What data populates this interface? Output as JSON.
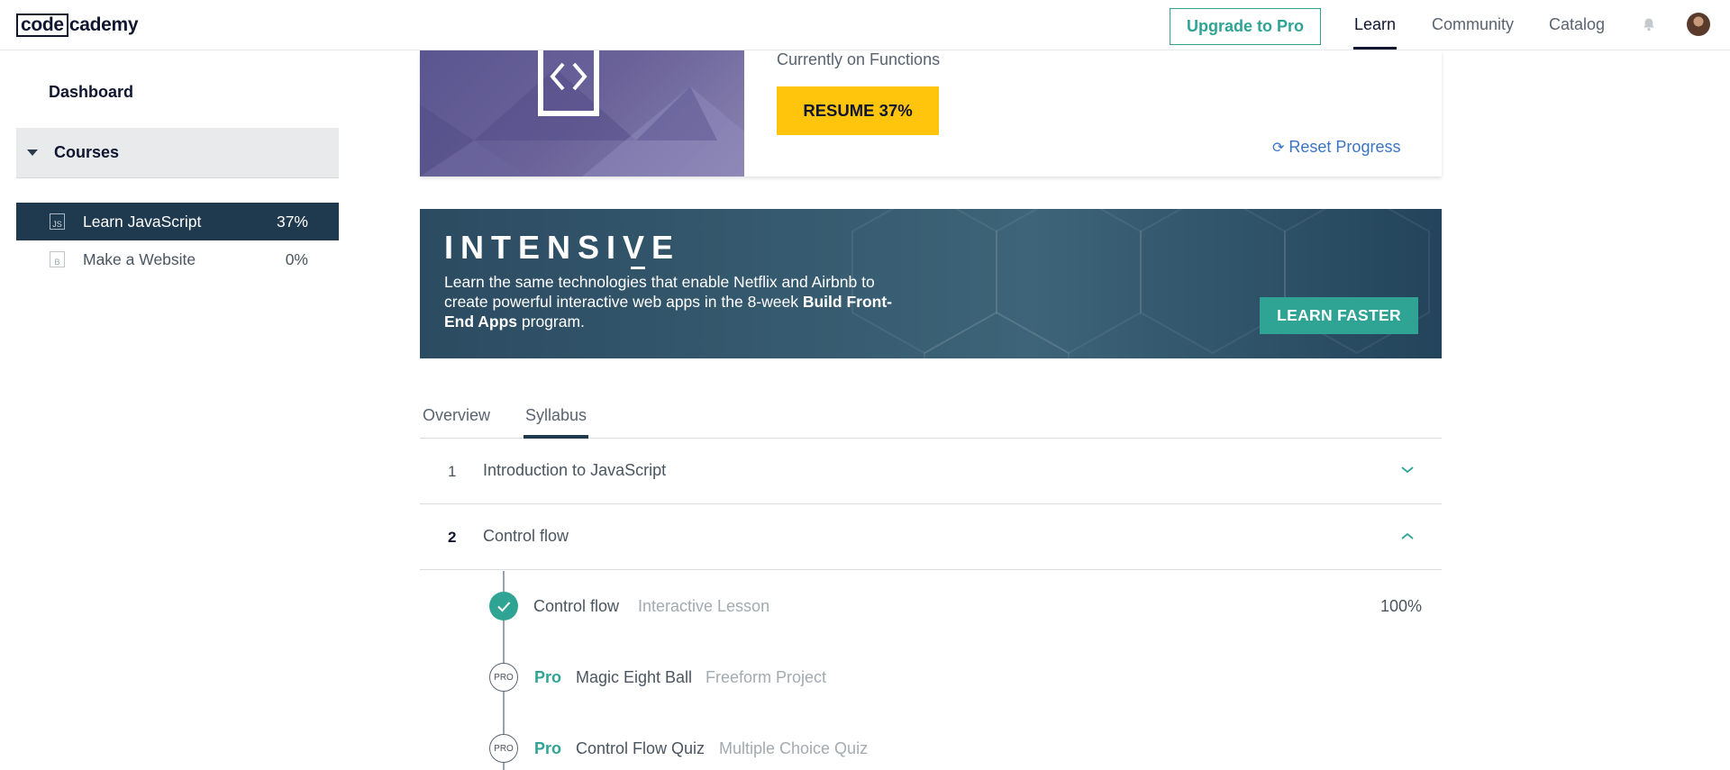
{
  "header": {
    "logo_box": "code",
    "logo_rest": "cademy",
    "upgrade_label": "Upgrade to Pro",
    "nav": [
      "Learn",
      "Community",
      "Catalog"
    ]
  },
  "sidebar": {
    "dashboard": "Dashboard",
    "courses_label": "Courses",
    "courses": [
      {
        "icon": "JS",
        "name": "Learn JavaScript",
        "pct": "37%",
        "active": true
      },
      {
        "icon": "B",
        "name": "Make a Website",
        "pct": "0%",
        "active": false
      }
    ]
  },
  "hero": {
    "currently": "Currently on Functions",
    "resume_label": "RESUME 37%",
    "reset_label": "Reset Progress"
  },
  "banner": {
    "title": "INTENSIVE",
    "desc_part1": "Learn the same technologies that enable Netflix and Airbnb to create powerful interactive web apps in the 8-week ",
    "desc_bold": "Build Front-End Apps",
    "desc_part2": " program.",
    "cta": "LEARN FASTER"
  },
  "tabs": [
    "Overview",
    "Syllabus"
  ],
  "syllabus": {
    "units": [
      {
        "num": "1",
        "name": "Introduction to JavaScript"
      },
      {
        "num": "2",
        "name": "Control flow"
      }
    ],
    "lessons": [
      {
        "name": "Control flow",
        "type": "Interactive Lesson",
        "pct": "100%"
      },
      {
        "pro": "Pro",
        "badge": "PRO",
        "name": "Magic Eight Ball",
        "type": "Freeform Project"
      },
      {
        "pro": "Pro",
        "badge": "PRO",
        "name": "Control Flow Quiz",
        "type": "Multiple Choice Quiz"
      }
    ]
  },
  "colors": {
    "accent": "#2fa495",
    "resume": "#ffc40c",
    "active_course_bg": "#1f3a4f",
    "link": "#3a75c4"
  }
}
